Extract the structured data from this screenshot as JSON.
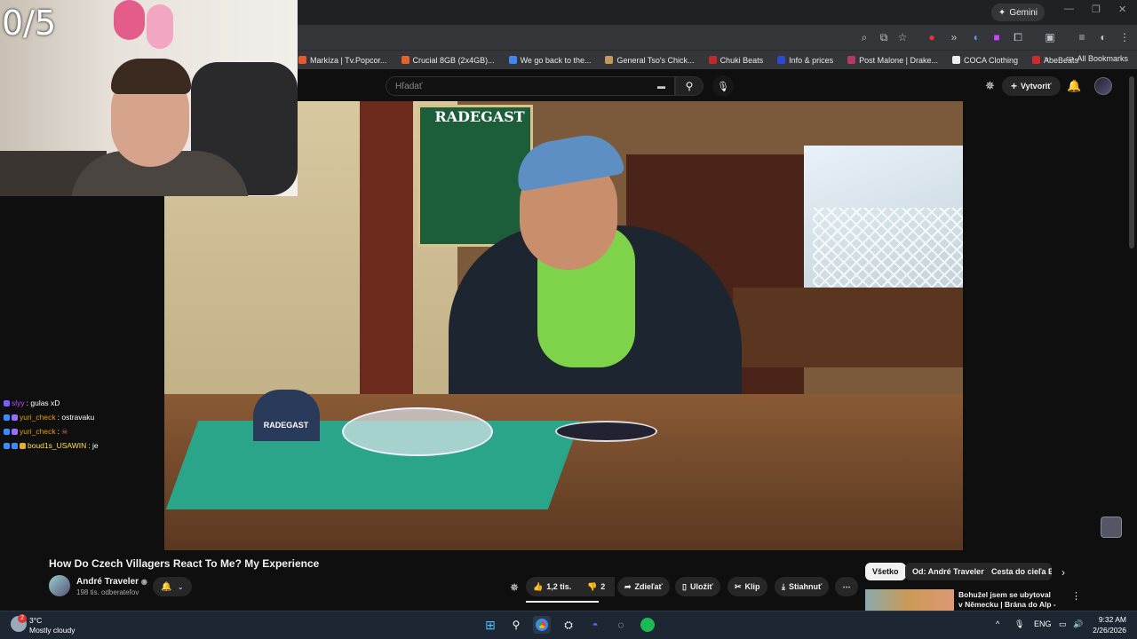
{
  "overlay": {
    "counter": "0/5"
  },
  "browser": {
    "gemini_label": "Gemini",
    "bookmarks": [
      {
        "label": "Markíza | Tv.Popcor...",
        "color": "#e25a2d"
      },
      {
        "label": "Crucial 8GB (2x4GB)...",
        "color": "#e2642d"
      },
      {
        "label": "We go back to the...",
        "color": "#4285f4"
      },
      {
        "label": "General Tso's Chick...",
        "color": "#c29a5b"
      },
      {
        "label": "Chuki Beats",
        "color": "#c22a2a"
      },
      {
        "label": "Info & prices",
        "color": "#2a4ad2"
      },
      {
        "label": "Post Malone | Drake...",
        "color": "#b23a6a"
      },
      {
        "label": "COCA Clothing",
        "color": "#eeeeee"
      },
      {
        "label": "AbeBeats",
        "color": "#d22a2a"
      }
    ],
    "all_bookmarks": "All Bookmarks"
  },
  "yt": {
    "search_placeholder": "Hľadať",
    "create_label": "Vytvoriť"
  },
  "chat": [
    {
      "user": "slyy",
      "user_color": "#b04aff",
      "text": ": gulas xD"
    },
    {
      "user": "yuri_check",
      "user_color": "#e0a000",
      "text": ": ostravaku"
    },
    {
      "user": "yuri_check",
      "user_color": "#e0a000",
      "text": ":"
    },
    {
      "user": "boud1s_USAWIN",
      "user_color": "#ffe050",
      "text": ": je"
    }
  ],
  "video_scene": {
    "sign_text": "RADEGAST",
    "standee_text": "RADEGAST"
  },
  "video": {
    "title": "How Do Czech Villagers React To Me? My Experience",
    "channel": "André Traveler",
    "subscribers": "198 tis. odberateľov",
    "likes": "1,2 tis.",
    "dislikes": "2",
    "share": "Zdieľať",
    "save": "Uložiť",
    "clip": "Klip",
    "download": "Stiahnuť"
  },
  "chips": [
    "Všetko",
    "Od: André Traveler",
    "Cesta do cieľa Eu"
  ],
  "recommendation": {
    "title": "Bohužel jsem se ubytoval v Německu | Brána do Alp - ..."
  },
  "taskbar": {
    "weather_temp": "3°C",
    "weather_desc": "Mostly cloudy",
    "weather_badge": "2",
    "lang": "ENG",
    "time": "9:32 AM",
    "date": "2/26/2026"
  }
}
